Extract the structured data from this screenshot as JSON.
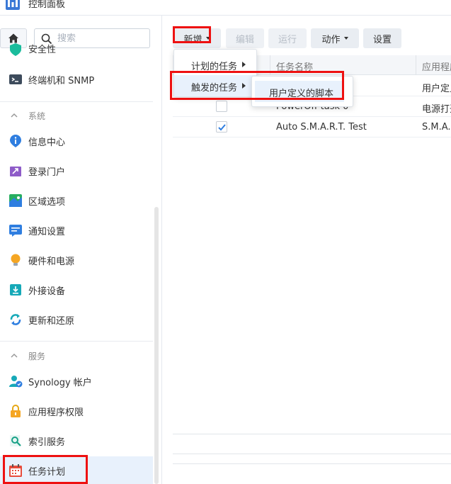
{
  "window": {
    "title": "控制面板"
  },
  "search": {
    "placeholder": "搜索"
  },
  "sidebar": {
    "partial_item": "安全性",
    "items_top": [
      {
        "label": "终端机和 SNMP",
        "icon": "terminal-icon"
      }
    ],
    "section_system": "系统",
    "items_system": [
      {
        "label": "信息中心",
        "icon": "info-icon"
      },
      {
        "label": "登录门户",
        "icon": "login-portal-icon"
      },
      {
        "label": "区域选项",
        "icon": "region-icon"
      },
      {
        "label": "通知设置",
        "icon": "notification-icon"
      },
      {
        "label": "硬件和电源",
        "icon": "hardware-power-icon"
      },
      {
        "label": "外接设备",
        "icon": "external-device-icon"
      },
      {
        "label": "更新和还原",
        "icon": "update-restore-icon"
      }
    ],
    "section_services": "服务",
    "items_services": [
      {
        "label": "Synology 帐户",
        "icon": "synology-account-icon"
      },
      {
        "label": "应用程序权限",
        "icon": "app-privilege-icon"
      },
      {
        "label": "索引服务",
        "icon": "index-service-icon"
      },
      {
        "label": "任务计划",
        "icon": "task-scheduler-icon"
      }
    ]
  },
  "toolbar": {
    "create": "新增",
    "edit": "编辑",
    "run": "运行",
    "action": "动作",
    "settings": "设置"
  },
  "grid": {
    "columns": [
      "任务名称",
      "应用程序"
    ],
    "rows": [
      {
        "checked": false,
        "name": "",
        "app": "用户定义"
      },
      {
        "checked": false,
        "name": "PowerOff task 0",
        "app": "电源打开"
      },
      {
        "checked": true,
        "name": "Auto S.M.A.R.T. Test",
        "app": "S.M.A.R.T."
      }
    ]
  },
  "menu": {
    "items": [
      "计划的任务",
      "触发的任务"
    ],
    "submenu": [
      "用户定义的脚本"
    ]
  },
  "colors": {
    "accent": "#2f7ee0",
    "highlight": "#ee1111",
    "active_bg": "#e8f1fc"
  }
}
